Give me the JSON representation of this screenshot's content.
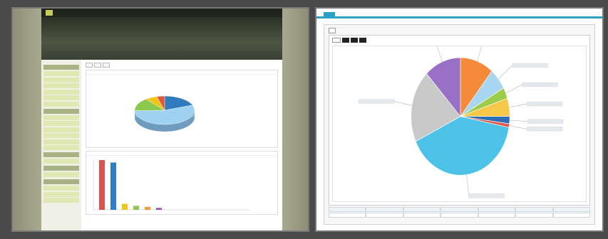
{
  "left": {
    "topnav": [
      "",
      "",
      ""
    ],
    "banner_lines": [
      "",
      ""
    ],
    "sidebar": {
      "sections": [
        {
          "title": "",
          "items": [
            "",
            "",
            "",
            "",
            "",
            ""
          ]
        },
        {
          "title": "",
          "items": [
            "",
            "",
            "",
            "",
            "",
            ""
          ]
        },
        {
          "title": "",
          "items": [
            ""
          ]
        },
        {
          "title": "",
          "items": [
            ""
          ]
        },
        {
          "title": "",
          "items": [
            "",
            "",
            ""
          ]
        }
      ]
    },
    "tabs": [
      "",
      "",
      ""
    ],
    "filter": "",
    "pie_caption": "",
    "bar_caption": "",
    "pie_colors": [
      "#2f7bbd",
      "#9fd2f0",
      "#8cc84b",
      "#f0c419",
      "#e05a3a"
    ],
    "bar_colors": [
      "#d9534f",
      "#2d7dc8",
      "#f0c419",
      "#8cc84b",
      "#f39c3a",
      "#9b59b6"
    ]
  },
  "right": {
    "tabs": [
      "",
      "",
      "",
      "",
      ""
    ],
    "subtab": "",
    "inner_tabs": [
      "",
      "",
      "",
      ""
    ],
    "table_cells": [
      "",
      "",
      "",
      "",
      "",
      "",
      ""
    ],
    "status": "",
    "pie_colors": [
      "#f58a3a",
      "#a8d6f0",
      "#9ccc4a",
      "#f5c84a",
      "#2d6fb5",
      "#e05a50",
      "#4cc3e6",
      "#c9c9c9",
      "#9a6fc6"
    ]
  },
  "chart_data": [
    {
      "type": "pie",
      "series": [
        {
          "values": [
            18,
            52,
            14,
            6,
            4
          ]
        }
      ]
    },
    {
      "type": "bar",
      "values": [
        100,
        95,
        12,
        8,
        6,
        4
      ]
    },
    {
      "type": "pie",
      "series": [
        {
          "values": [
            11,
            6,
            3,
            5,
            2,
            1,
            40,
            20,
            12
          ]
        }
      ]
    }
  ]
}
